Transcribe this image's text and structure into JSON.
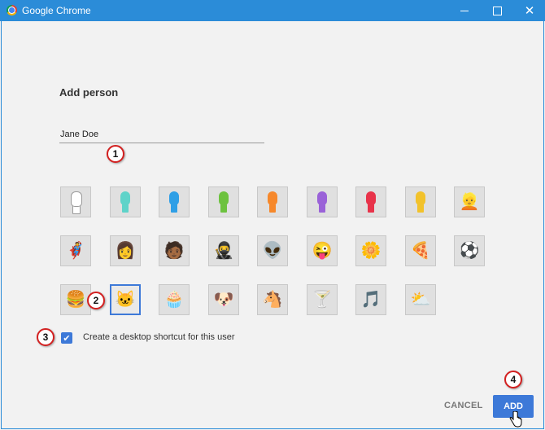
{
  "window": {
    "title": "Google Chrome"
  },
  "dialog": {
    "heading": "Add person",
    "name_value": "Jane Doe",
    "avatars": [
      {
        "name": "avatar-generic-white",
        "icon": "person-silhouette",
        "color": "#ffffff"
      },
      {
        "name": "avatar-generic-teal",
        "icon": "person-silhouette",
        "color": "#5fd3c9"
      },
      {
        "name": "avatar-generic-blue",
        "icon": "person-silhouette",
        "color": "#2f9fe6"
      },
      {
        "name": "avatar-generic-green",
        "icon": "person-silhouette",
        "color": "#6dc23f"
      },
      {
        "name": "avatar-generic-orange",
        "icon": "person-silhouette",
        "color": "#f6882b"
      },
      {
        "name": "avatar-generic-purple",
        "icon": "person-silhouette",
        "color": "#9a62d8"
      },
      {
        "name": "avatar-generic-red",
        "icon": "person-silhouette",
        "color": "#e8334a"
      },
      {
        "name": "avatar-generic-yellow",
        "icon": "person-silhouette",
        "color": "#f2c22b"
      },
      {
        "name": "avatar-businessman",
        "icon": "businessman",
        "glyph": "👱"
      },
      {
        "name": "avatar-hero",
        "icon": "hero",
        "glyph": "🦸"
      },
      {
        "name": "avatar-superwoman",
        "icon": "superwoman",
        "glyph": "👩"
      },
      {
        "name": "avatar-person-dark",
        "icon": "person",
        "glyph": "🧑🏾"
      },
      {
        "name": "avatar-ninja",
        "icon": "ninja",
        "glyph": "🥷"
      },
      {
        "name": "avatar-alien",
        "icon": "alien",
        "glyph": "👽"
      },
      {
        "name": "avatar-awesome-face",
        "icon": "smiley",
        "glyph": "😜"
      },
      {
        "name": "avatar-flower",
        "icon": "flower",
        "glyph": "🌼"
      },
      {
        "name": "avatar-pizza",
        "icon": "pizza",
        "glyph": "🍕"
      },
      {
        "name": "avatar-soccer",
        "icon": "soccer-ball",
        "glyph": "⚽"
      },
      {
        "name": "avatar-burger",
        "icon": "burger",
        "glyph": "🍔"
      },
      {
        "name": "avatar-cat",
        "icon": "cat",
        "glyph": "🐱",
        "selected": true
      },
      {
        "name": "avatar-cupcake",
        "icon": "cupcake",
        "glyph": "🧁"
      },
      {
        "name": "avatar-dog",
        "icon": "dog",
        "glyph": "🐶"
      },
      {
        "name": "avatar-horse",
        "icon": "horse",
        "glyph": "🐴"
      },
      {
        "name": "avatar-drink",
        "icon": "cocktail",
        "glyph": "🍸"
      },
      {
        "name": "avatar-music",
        "icon": "music-note",
        "glyph": "🎵"
      },
      {
        "name": "avatar-sun-cloud",
        "icon": "sun-behind-cloud",
        "glyph": "⛅"
      }
    ],
    "checkbox": {
      "checked": true,
      "label": "Create a desktop shortcut for this user"
    },
    "cancel_label": "CANCEL",
    "add_label": "ADD"
  },
  "callouts": [
    "1",
    "2",
    "3",
    "4"
  ],
  "colors": {
    "titlebar": "#2b8cd8",
    "accent": "#3d79d8",
    "callout_ring": "#d32020"
  }
}
